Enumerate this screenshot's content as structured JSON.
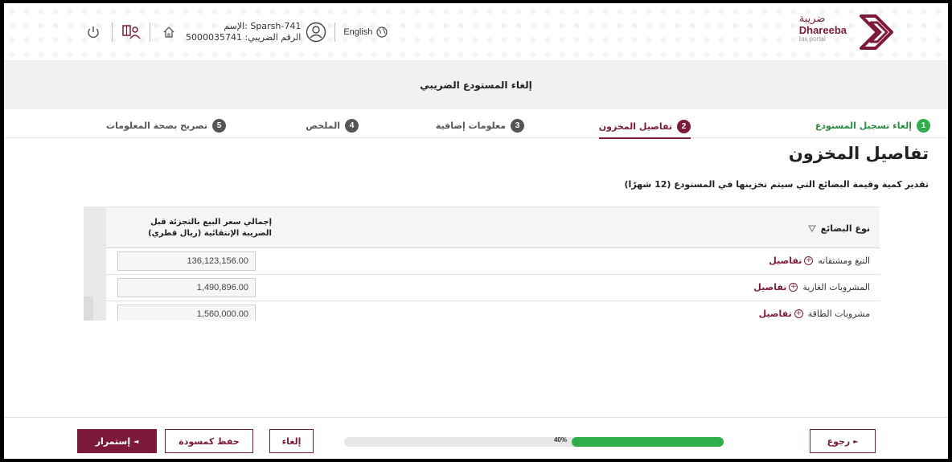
{
  "header": {
    "logo_ar": "ضريبة",
    "logo_en": "Dhareeba",
    "logo_sub": "tax portal",
    "language": "English",
    "user_name": "الإسم: Sparsh-741",
    "tax_number": "الرقم الضريبي: 5000035741",
    "icons": [
      "power-icon",
      "users-book-icon",
      "home-icon",
      "user-circle-icon",
      "globe-icon"
    ]
  },
  "page": {
    "title": "إلغاء المستودع الضريبي"
  },
  "stepper": {
    "steps": [
      {
        "num": "1",
        "label": "إلغاء تسجيل المستودع",
        "state": "done"
      },
      {
        "num": "2",
        "label": "تفاصيل المخزون",
        "state": "active"
      },
      {
        "num": "3",
        "label": "معلومات إضافية",
        "state": "pending"
      },
      {
        "num": "4",
        "label": "الملخص",
        "state": "pending"
      },
      {
        "num": "5",
        "label": "تصريح بصحة المعلومات",
        "state": "pending"
      }
    ]
  },
  "section": {
    "title": "تفاصيل المخزون",
    "subtitle": "تقدير كمية وقيمة البضائع التي سيتم تخزينها في المستودع (12 شهرًا)"
  },
  "table": {
    "col_type": "نوع البضائع",
    "col_total_line1": "إجمالي سعر البيع بالتجزئة قبل",
    "col_total_line2": "الضريبة الإنتقائية (ريال قطري)",
    "details_label": "تفاصيل",
    "rows": [
      {
        "name": "التبغ ومشتقاته",
        "value": "136,123,156.00"
      },
      {
        "name": "المشروبات الغازية",
        "value": "1,490,896.00"
      },
      {
        "name": "مشروبات الطاقة",
        "value": "1,560,000.00"
      }
    ]
  },
  "footer": {
    "back_label": "رجوع",
    "progress_text": "40%",
    "progress_value": 0.4,
    "cancel_label": "إلغاء",
    "save_draft_label": "حفظ كمسودة",
    "continue_label": "إستمرار"
  },
  "colors": {
    "brand": "#7d1a3a",
    "success": "#2fae4a",
    "band": "#f1f1f1"
  }
}
